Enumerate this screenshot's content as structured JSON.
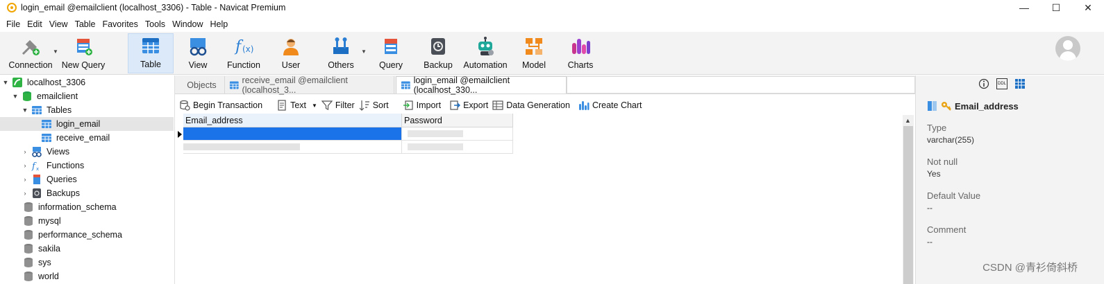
{
  "window": {
    "title": "login_email @emailclient (localhost_3306) - Table - Navicat Premium",
    "minimize_glyph": "—",
    "maximize_glyph": "☐",
    "close_glyph": "✕"
  },
  "menu": [
    "File",
    "Edit",
    "View",
    "Table",
    "Favorites",
    "Tools",
    "Window",
    "Help"
  ],
  "ribbon": {
    "connection": "Connection",
    "new_query": "New Query",
    "table": "Table",
    "view": "View",
    "function": "Function",
    "user": "User",
    "others": "Others",
    "query": "Query",
    "backup": "Backup",
    "automation": "Automation",
    "model": "Model",
    "charts": "Charts"
  },
  "tree": {
    "connection": "localhost_3306",
    "database": "emailclient",
    "tables_folder": "Tables",
    "tables": [
      "login_email",
      "receive_email"
    ],
    "views": "Views",
    "functions": "Functions",
    "queries": "Queries",
    "backups": "Backups",
    "other_dbs": [
      "information_schema",
      "mysql",
      "performance_schema",
      "sakila",
      "sys",
      "world"
    ]
  },
  "tabs": {
    "objects": "Objects",
    "tab1": "receive_email @emailclient (localhost_3...",
    "tab2": "login_email @emailclient (localhost_330..."
  },
  "table_toolbar": {
    "begin_transaction": "Begin Transaction",
    "text": "Text",
    "filter": "Filter",
    "sort": "Sort",
    "import": "Import",
    "export": "Export",
    "data_generation": "Data Generation",
    "create_chart": "Create Chart"
  },
  "grid": {
    "columns": [
      "Email_address",
      "Password"
    ]
  },
  "info_panel": {
    "field_name": "Email_address",
    "type_label": "Type",
    "type_value": "varchar(255)",
    "notnull_label": "Not null",
    "notnull_value": "Yes",
    "default_label": "Default Value",
    "default_value": "--",
    "comment_label": "Comment",
    "comment_value": "--",
    "ddl_icon_text": "DDL"
  },
  "watermark": "CSDN @青衫倚斜桥",
  "colors": {
    "accent": "#1a73e8",
    "selected_row": "#1a73e8",
    "ribbon_bg": "#f3f3f3",
    "active_ribbon": "#dbe9f8"
  }
}
